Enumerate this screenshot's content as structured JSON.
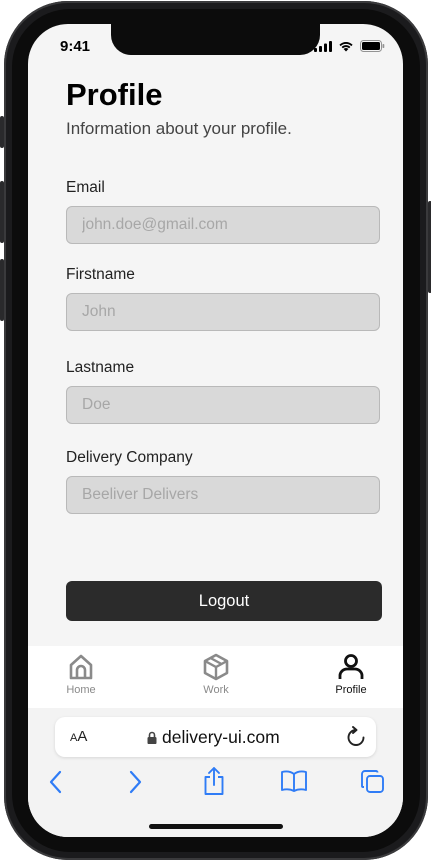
{
  "status_bar": {
    "time": "9:41"
  },
  "profile": {
    "title": "Profile",
    "subtitle": "Information about your profile.",
    "fields": [
      {
        "label": "Email",
        "placeholder": "john.doe@gmail.com"
      },
      {
        "label": "Firstname",
        "placeholder": "John"
      },
      {
        "label": "Lastname",
        "placeholder": "Doe"
      },
      {
        "label": "Delivery Company",
        "placeholder": "Beeliver Delivers"
      }
    ],
    "logout_label": "Logout"
  },
  "tabbar": {
    "active": "Profile",
    "items": [
      {
        "label": "Home",
        "icon": "home-icon"
      },
      {
        "label": "Work",
        "icon": "package-icon"
      },
      {
        "label": "Profile",
        "icon": "user-icon"
      }
    ]
  },
  "browser": {
    "text_size_label_small": "A",
    "text_size_label_large": "A",
    "url": "delivery-ui.com",
    "toolbar_icons": [
      "back-icon",
      "forward-icon",
      "share-icon",
      "bookmarks-icon",
      "tabs-icon"
    ]
  },
  "colors": {
    "accent_blue": "#2f7cf6",
    "button_dark": "#2b2b2b",
    "field_bg": "#d9d9d9",
    "inactive_tab": "#8a8a8a"
  }
}
